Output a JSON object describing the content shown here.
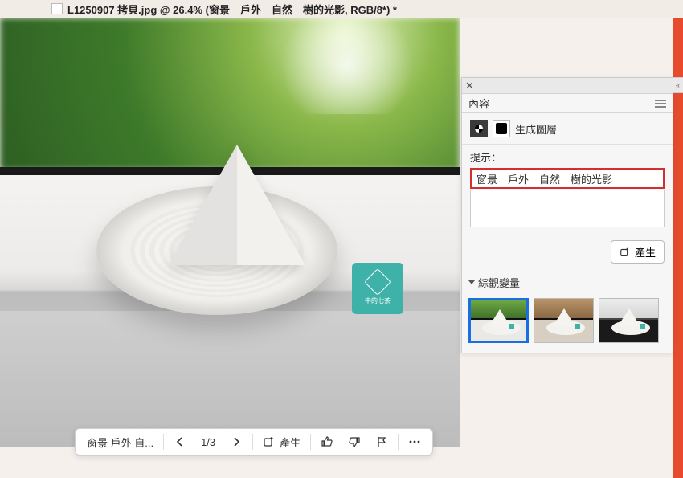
{
  "titlebar": {
    "filename": "L1250907 拷貝.jpg @ 26.4% (窗景　戶外　自然　樹的光影, RGB/8*) *"
  },
  "panel": {
    "tab_label": "內容",
    "layer_label": "生成圖層",
    "prompt_label": "提示：",
    "prompt_text": "窗景　戶外　自然　樹的光影",
    "generate_label": "產生",
    "variations_label": "綜觀變量"
  },
  "floatbar": {
    "prompt_short": "窗景 戶外 自...",
    "page": "1/3",
    "generate": "產生"
  },
  "tag_text": "中的七茶"
}
